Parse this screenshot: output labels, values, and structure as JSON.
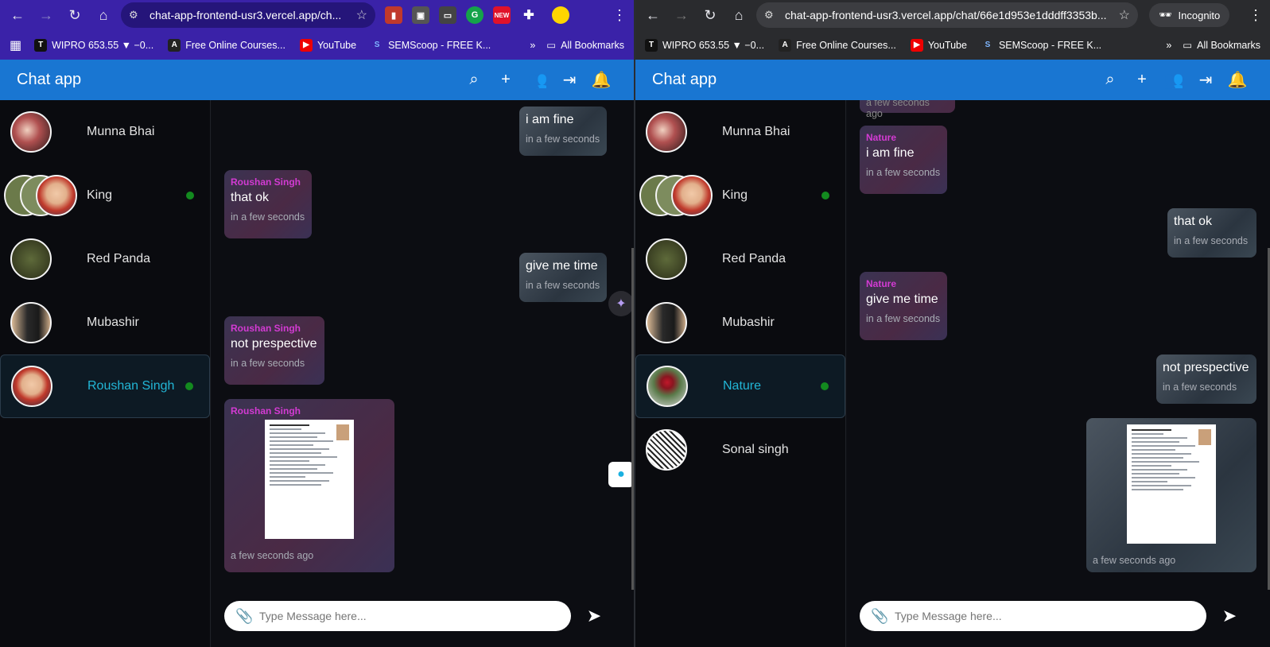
{
  "left": {
    "url": "chat-app-frontend-usr3.vercel.app/ch...",
    "bookmarks": [
      "WIPRO 653.55 ▼ −0...",
      "Free Online Courses...",
      "YouTube",
      "SEMScoop - FREE K..."
    ],
    "bookmarks_more": "»",
    "all_bookmarks": "All Bookmarks",
    "ext_new": "NEW",
    "app_title": "Chat app",
    "chats": [
      {
        "name": "Munna Bhai"
      },
      {
        "name": "King"
      },
      {
        "name": "Red Panda"
      },
      {
        "name": "Mubashir"
      },
      {
        "name": "Roushan Singh"
      }
    ],
    "messages": [
      {
        "text": "i am fine",
        "time": "in a few seconds"
      },
      {
        "sender": "Roushan Singh",
        "text": "that ok",
        "time": "in a few seconds"
      },
      {
        "text": "give me time",
        "time": "in a few seconds"
      },
      {
        "sender": "Roushan Singh",
        "text": "not prespective",
        "time": "in a few seconds"
      },
      {
        "sender": "Roushan Singh",
        "time": "a few seconds ago"
      }
    ],
    "placeholder": "Type Message here..."
  },
  "right": {
    "url": "chat-app-frontend-usr3.vercel.app/chat/66e1d953e1dddff3353b...",
    "incognito": "Incognito",
    "bookmarks": [
      "WIPRO 653.55 ▼ −0...",
      "Free Online Courses...",
      "YouTube",
      "SEMScoop - FREE K..."
    ],
    "bookmarks_more": "»",
    "all_bookmarks": "All Bookmarks",
    "app_title": "Chat app",
    "chats": [
      {
        "name": "Munna Bhai"
      },
      {
        "name": "King"
      },
      {
        "name": "Red Panda"
      },
      {
        "name": "Mubashir"
      },
      {
        "name": "Nature"
      },
      {
        "name": "Sonal singh"
      }
    ],
    "messages": [
      {
        "text": "a few seconds ago"
      },
      {
        "sender": "Nature",
        "text": "i am fine",
        "time": "in a few seconds"
      },
      {
        "text": "that ok",
        "time": "in a few seconds"
      },
      {
        "sender": "Nature",
        "text": "give me time",
        "time": "in a few seconds"
      },
      {
        "text": "not prespective",
        "time": "in a few seconds"
      },
      {
        "time": "a few seconds ago"
      }
    ],
    "placeholder": "Type Message here..."
  },
  "colors": {
    "appbar": "#1976d2",
    "sender": "#d33bd3",
    "active_name": "#22b6d6",
    "online": "#138a1f"
  }
}
